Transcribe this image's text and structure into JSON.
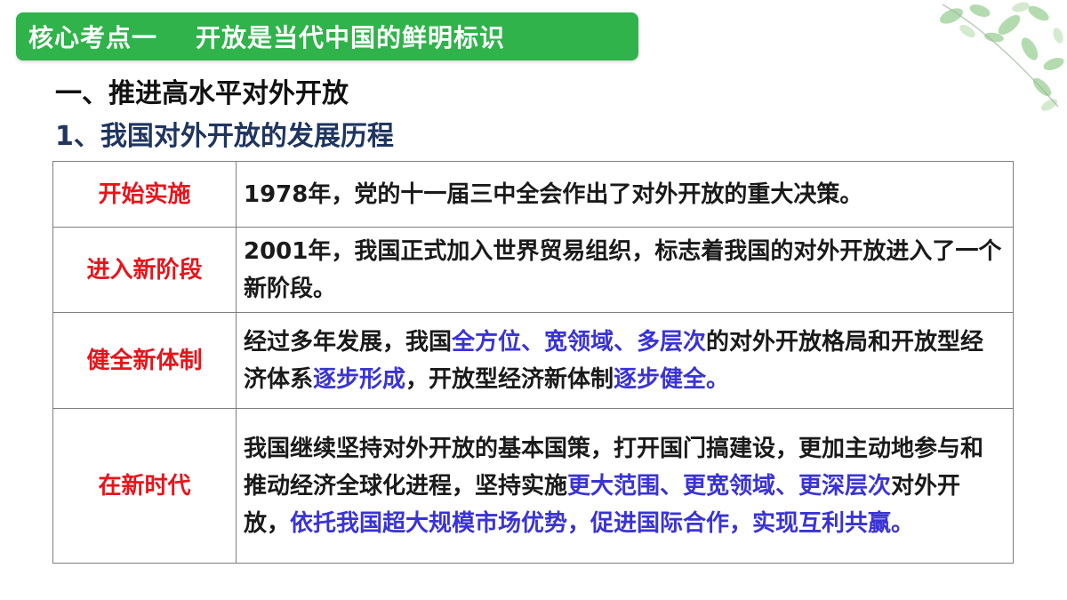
{
  "banner": {
    "title": "核心考点一    开放是当代中国的鲜明标识"
  },
  "section_heading": "一、推进高水平对外开放",
  "sub_heading": "1、我国对外开放的发展历程",
  "rows": [
    {
      "stage": "开始实施",
      "segments": [
        {
          "text": "1978年，党的十一届三中全会作出了对外开放的重大决策。",
          "hl": false
        }
      ]
    },
    {
      "stage": "进入新阶段",
      "segments": [
        {
          "text": "2001年，我国正式加入世界贸易组织，标志着我国的对外开放进入了一个新阶段。",
          "hl": false
        }
      ]
    },
    {
      "stage": "健全新体制",
      "segments": [
        {
          "text": "经过多年发展，我国",
          "hl": false
        },
        {
          "text": "全方位、宽领域、多层次",
          "hl": true
        },
        {
          "text": "的对外开放格局和开放型经济体系",
          "hl": false
        },
        {
          "text": "逐步形成",
          "hl": true
        },
        {
          "text": "，开放型经济新体制",
          "hl": false
        },
        {
          "text": "逐步健全。",
          "hl": true
        }
      ]
    },
    {
      "stage": "在新时代",
      "segments": [
        {
          "text": "我国继续坚持对外开放的基本国策，打开国门搞建设，更加主动地参与和推动经济全球化进程，坚持实施",
          "hl": false
        },
        {
          "text": "更大范围、更宽领域、更深层次",
          "hl": true
        },
        {
          "text": "对外开放，",
          "hl": false
        },
        {
          "text": "依托我国超大规模市场优势，促进国际合作，实现互利共赢。",
          "hl": true
        }
      ]
    }
  ],
  "colors": {
    "banner_bg": "#2fb34a",
    "stage_text": "#e8141b",
    "highlight_text": "#3a33d6"
  },
  "decoration": {
    "leaves_icon": "leaves-icon"
  }
}
